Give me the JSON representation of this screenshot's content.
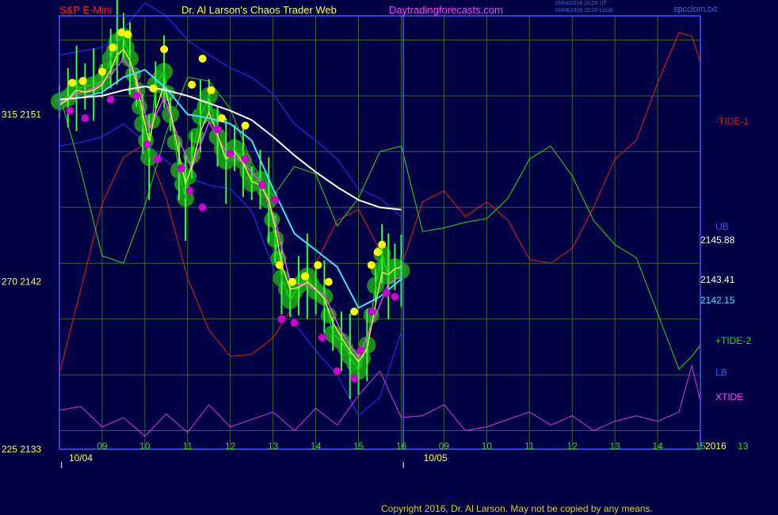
{
  "header": {
    "symbol": "S&P E-Mini",
    "author": "Dr. Al Larson's Chaos Trader Web",
    "site": "Daytradingforecasts.com",
    "timestamp_ut": "10/04/2016 20:20 UT",
    "timestamp_local": "10/04/2016 15:20 Local",
    "file": "spcclom.txt"
  },
  "footer": {
    "copyright": "Copyright 2016, Dr. Al Larson. May not be copied by any means."
  },
  "colors": {
    "background": "#000044",
    "grid": "#2e6a2e",
    "frame": "#3b5bff",
    "price": "#00dd00",
    "yellow_line": "#ffff40",
    "magenta_line": "#ff40ff",
    "cyan_ma": "#40e0ff",
    "white_ma": "#ffffff",
    "blue_band": "#2a2ae8",
    "tide1": "#dd1a1a",
    "tide2": "#22cc22",
    "xtide": "#cc33cc",
    "high_dot": "#ffff00",
    "low_dot": "#cc00cc",
    "glow": "#1f9a1f"
  },
  "chart_data": {
    "type": "line",
    "title": "S&P E-Mini",
    "y_axis_left": {
      "ticks": [
        {
          "label": "225  2133",
          "price": 2133
        },
        {
          "label": "270  2142",
          "price": 2142
        },
        {
          "label": "315  2151",
          "price": 2151
        }
      ],
      "range": [
        2133,
        2156.3
      ]
    },
    "x_axis": {
      "hour_ticks": [
        "09",
        "10",
        "11",
        "12",
        "13",
        "14",
        "15",
        "16",
        "09",
        "10",
        "11",
        "12",
        "13",
        "14",
        "15",
        "13"
      ],
      "date_labels": [
        "10/04",
        "10/05"
      ],
      "end_label": "2016",
      "range_hours": [
        8.0,
        23.0
      ],
      "now_hour": 16.05
    },
    "right_labels": [
      {
        "text": "-TIDE-1",
        "series": "-TIDE-1"
      },
      {
        "text": "UB",
        "series": "UB"
      },
      {
        "text": "2145.88",
        "price": 2145.88,
        "series": "White moving average"
      },
      {
        "text": "2143.41",
        "price": 2143.41
      },
      {
        "text": "2142.15",
        "price": 2142.15,
        "series": "Cyan moving average"
      },
      {
        "text": "+TIDE-2",
        "series": "+TIDE-2"
      },
      {
        "text": "LB",
        "series": "LB"
      },
      {
        "text": "XTIDE",
        "series": "XTIDE"
      }
    ],
    "series": [
      {
        "name": "S&P E-Mini price (close)",
        "color": "#00dd00",
        "x": [
          8.0,
          8.2,
          8.4,
          8.6,
          8.8,
          9.0,
          9.2,
          9.35,
          9.5,
          9.65,
          9.8,
          9.95,
          10.1,
          10.25,
          10.45,
          10.6,
          10.8,
          10.95,
          11.1,
          11.3,
          11.5,
          11.7,
          11.9,
          12.1,
          12.3,
          12.5,
          12.7,
          12.9,
          13.05,
          13.2,
          13.4,
          13.6,
          13.8,
          14.0,
          14.2,
          14.4,
          14.6,
          14.8,
          15.0,
          15.2,
          15.4,
          15.55,
          15.7,
          15.85,
          16.0
        ],
        "y": [
          2151.7,
          2151.9,
          2152.4,
          2152.5,
          2152.6,
          2152.8,
          2154.0,
          2154.9,
          2155.2,
          2154.0,
          2152.3,
          2150.5,
          2148.7,
          2152.6,
          2153.3,
          2151.0,
          2148.0,
          2146.5,
          2148.8,
          2150.9,
          2152.0,
          2149.8,
          2148.5,
          2149.2,
          2148.5,
          2147.3,
          2147.5,
          2146.4,
          2144.3,
          2142.2,
          2141.0,
          2141.8,
          2142.3,
          2141.5,
          2141.2,
          2139.2,
          2138.8,
          2138.0,
          2137.2,
          2138.6,
          2141.8,
          2143.5,
          2142.3,
          2142.8,
          2142.6
        ]
      },
      {
        "name": "Yellow fast line",
        "color": "#ffff40",
        "x": [
          8.0,
          8.2,
          8.4,
          8.6,
          8.8,
          9.0,
          9.2,
          9.35,
          9.5,
          9.65,
          9.8,
          9.95,
          10.1,
          10.25,
          10.45,
          10.6,
          10.8,
          10.95,
          11.1,
          11.3,
          11.5,
          11.7,
          11.9,
          12.1,
          12.3,
          12.5,
          12.7,
          12.9,
          13.05,
          13.2,
          13.4,
          13.6,
          13.8,
          14.0,
          14.2,
          14.4,
          14.6,
          14.8,
          15.0,
          15.2,
          15.4,
          15.55,
          15.7,
          15.85,
          16.0
        ],
        "y": [
          2151.5,
          2151.8,
          2152.3,
          2152.2,
          2152.3,
          2152.6,
          2153.4,
          2154.2,
          2154.5,
          2153.9,
          2152.8,
          2151.0,
          2149.5,
          2151.2,
          2152.6,
          2151.2,
          2148.8,
          2147.3,
          2148.2,
          2150.1,
          2151.1,
          2149.9,
          2148.6,
          2149.0,
          2148.4,
          2147.4,
          2147.2,
          2146.4,
          2144.9,
          2142.9,
          2141.6,
          2141.7,
          2142.0,
          2141.6,
          2141.1,
          2139.8,
          2139.0,
          2138.3,
          2137.7,
          2138.4,
          2140.8,
          2142.5,
          2142.4,
          2142.7,
          2142.8
        ]
      },
      {
        "name": "Magenta slow line",
        "color": "#ff40ff",
        "x": [
          8.0,
          8.4,
          8.8,
          9.2,
          9.5,
          9.8,
          10.1,
          10.45,
          10.8,
          11.1,
          11.5,
          11.9,
          12.3,
          12.7,
          13.05,
          13.4,
          13.8,
          14.2,
          14.6,
          15.0,
          15.4,
          15.7,
          16.0
        ],
        "y": [
          2151.6,
          2152.1,
          2152.4,
          2153.1,
          2154.0,
          2153.0,
          2150.2,
          2151.9,
          2149.6,
          2148.1,
          2150.6,
          2149.0,
          2148.4,
          2147.4,
          2145.3,
          2142.0,
          2141.8,
          2141.3,
          2139.3,
          2137.9,
          2140.2,
          2141.9,
          2142.3
        ]
      },
      {
        "name": "Cyan moving average",
        "color": "#40e0ff",
        "x": [
          8.0,
          8.5,
          9.0,
          9.5,
          10.0,
          10.5,
          11.0,
          11.5,
          12.0,
          12.5,
          13.0,
          13.5,
          14.0,
          14.5,
          15.0,
          15.5,
          16.0
        ],
        "y": [
          2151.8,
          2151.9,
          2152.2,
          2153.0,
          2153.4,
          2152.4,
          2151.0,
          2150.8,
          2150.5,
          2149.6,
          2147.0,
          2144.6,
          2143.7,
          2142.8,
          2140.6,
          2141.2,
          2142.15
        ]
      },
      {
        "name": "White moving average",
        "color": "#ffffff",
        "x": [
          8.0,
          8.5,
          9.0,
          9.5,
          10.0,
          10.5,
          11.0,
          11.5,
          12.0,
          12.5,
          13.0,
          13.5,
          14.0,
          14.5,
          15.0,
          15.5,
          16.0
        ],
        "y": [
          2151.8,
          2151.9,
          2152.0,
          2152.3,
          2152.5,
          2152.3,
          2152.0,
          2151.6,
          2151.2,
          2150.7,
          2149.8,
          2148.8,
          2147.9,
          2147.1,
          2146.4,
          2146.0,
          2145.88
        ]
      },
      {
        "name": "UB",
        "color": "#2a2ae8",
        "x": [
          8.0,
          8.5,
          9.0,
          9.5,
          10.0,
          10.5,
          11.0,
          11.5,
          12.0,
          12.5,
          13.0,
          13.5,
          14.0,
          14.5,
          15.0,
          15.5,
          16.0
        ],
        "y": [
          2154.2,
          2154.4,
          2154.6,
          2155.6,
          2157.0,
          2156.3,
          2155.0,
          2154.2,
          2153.5,
          2153.0,
          2152.1,
          2150.5,
          2149.6,
          2148.6,
          2147.0,
          2146.5,
          2145.5
        ]
      },
      {
        "name": "LB",
        "color": "#2a2ae8",
        "x": [
          8.0,
          8.5,
          9.0,
          9.5,
          10.0,
          10.5,
          11.0,
          11.5,
          12.0,
          12.5,
          13.0,
          13.5,
          14.0,
          14.5,
          15.0,
          15.5,
          16.0
        ],
        "y": [
          2149.3,
          2149.5,
          2149.8,
          2150.5,
          2149.5,
          2148.5,
          2147.6,
          2147.2,
          2147.0,
          2145.8,
          2142.8,
          2139.8,
          2138.3,
          2137.0,
          2134.8,
          2135.8,
          2139.3
        ]
      },
      {
        "name": "-TIDE-1",
        "color": "#dd1a1a",
        "x": [
          8.0,
          8.5,
          9.0,
          9.5,
          10.0,
          10.5,
          11.0,
          11.5,
          12.0,
          12.5,
          13.0,
          13.5,
          14.0,
          14.5,
          15.0,
          15.5,
          16.0,
          16.5,
          17.0,
          17.5,
          18.0,
          18.5,
          19.0,
          19.5,
          20.0,
          20.5,
          21.0,
          21.5,
          22.0,
          22.5,
          22.8,
          23.0
        ],
        "y": [
          2137.1,
          2141.6,
          2146.2,
          2148.7,
          2149.4,
          2146.5,
          2142.2,
          2139.4,
          2138.0,
          2138.1,
          2139.0,
          2140.8,
          2143.0,
          2145.3,
          2145.9,
          2143.7,
          2142.8,
          2146.3,
          2146.9,
          2145.5,
          2146.3,
          2145.3,
          2143.2,
          2143.0,
          2143.8,
          2146.0,
          2148.6,
          2149.6,
          2152.7,
          2155.4,
          2155.2,
          2153.8
        ]
      },
      {
        "name": "+TIDE-2",
        "color": "#22cc22",
        "x": [
          8.0,
          8.5,
          9.0,
          9.5,
          10.0,
          10.5,
          11.0,
          11.5,
          12.0,
          12.5,
          13.0,
          13.5,
          14.0,
          14.5,
          15.0,
          15.5,
          16.0,
          16.5,
          17.0,
          17.5,
          18.0,
          18.5,
          19.0,
          19.5,
          20.0,
          20.5,
          21.0,
          21.5,
          22.0,
          22.5,
          22.8,
          23.0
        ],
        "y": [
          2152.1,
          2148.0,
          2143.4,
          2143.0,
          2146.1,
          2150.0,
          2153.0,
          2152.8,
          2151.3,
          2148.4,
          2146.6,
          2148.2,
          2147.8,
          2145.0,
          2146.5,
          2149.0,
          2149.3,
          2144.7,
          2144.9,
          2145.2,
          2145.4,
          2146.5,
          2148.6,
          2149.3,
          2147.7,
          2145.3,
          2144.0,
          2143.3,
          2140.3,
          2137.3,
          2138.0,
          2138.6
        ]
      },
      {
        "name": "XTIDE",
        "color": "#cc33cc",
        "x": [
          8.0,
          8.5,
          9.0,
          9.5,
          10.0,
          10.5,
          11.0,
          11.5,
          12.0,
          12.5,
          13.0,
          13.5,
          14.0,
          14.5,
          15.0,
          15.5,
          16.0,
          16.5,
          17.0,
          17.5,
          18.0,
          18.5,
          19.0,
          19.5,
          20.0,
          20.5,
          21.0,
          21.5,
          22.0,
          22.5,
          22.8,
          23.0
        ],
        "y": [
          2135.1,
          2135.3,
          2134.2,
          2134.7,
          2133.7,
          2134.9,
          2133.9,
          2135.4,
          2134.2,
          2134.6,
          2135.0,
          2134.0,
          2135.2,
          2134.3,
          2135.9,
          2137.2,
          2134.7,
          2134.8,
          2135.4,
          2134.0,
          2134.2,
          2134.6,
          2135.0,
          2134.3,
          2134.8,
          2134.0,
          2134.5,
          2134.8,
          2134.5,
          2135.0,
          2137.5,
          2135.6
        ]
      },
      {
        "name": "Swing highs",
        "color": "#ffff00",
        "x": [
          8.3,
          8.55,
          9.0,
          9.25,
          9.45,
          9.6,
          10.2,
          10.45,
          11.1,
          11.35,
          11.55,
          11.8,
          12.35,
          13.15,
          13.45,
          13.75,
          14.05,
          14.3,
          14.9,
          15.3,
          15.45,
          15.55
        ],
        "y": [
          2152.7,
          2152.8,
          2153.3,
          2154.6,
          2155.4,
          2155.3,
          2152.4,
          2154.5,
          2152.6,
          2154.0,
          2152.3,
          2150.8,
          2150.4,
          2142.9,
          2142.0,
          2142.3,
          2142.9,
          2142.0,
          2140.4,
          2142.9,
          2143.6,
          2144.0
        ]
      },
      {
        "name": "Swing lows",
        "color": "#cc00cc",
        "x": [
          8.25,
          8.6,
          9.2,
          9.8,
          10.05,
          10.3,
          10.85,
          11.05,
          11.35,
          11.7,
          12.0,
          12.35,
          12.75,
          13.05,
          13.2,
          13.5,
          14.15,
          14.5,
          14.9,
          15.05,
          15.3,
          15.65,
          15.85
        ],
        "y": [
          2151.2,
          2150.8,
          2151.8,
          2152.0,
          2149.4,
          2148.6,
          2148.1,
          2146.9,
          2146.0,
          2150.2,
          2148.9,
          2148.6,
          2147.2,
          2146.4,
          2140.0,
          2139.8,
          2139.0,
          2137.2,
          2136.8,
          2138.3,
          2140.4,
          2141.4,
          2141.2
        ]
      }
    ]
  }
}
